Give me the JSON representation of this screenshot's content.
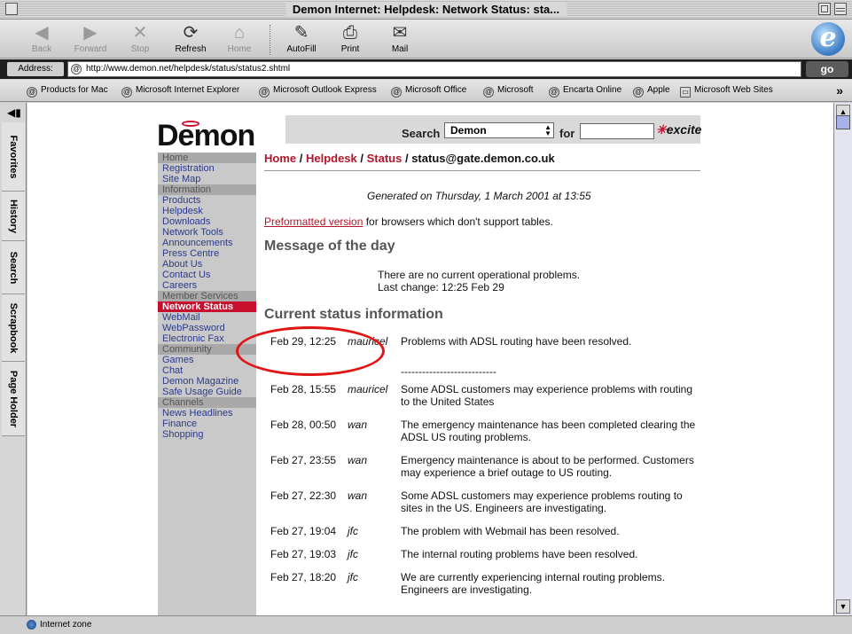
{
  "window": {
    "title": "Demon Internet: Helpdesk: Network Status: sta..."
  },
  "toolbar": {
    "back": "Back",
    "forward": "Forward",
    "stop": "Stop",
    "refresh": "Refresh",
    "home": "Home",
    "autofill": "AutoFill",
    "print": "Print",
    "mail": "Mail"
  },
  "address": {
    "label": "Address:",
    "url": "http://www.demon.net/helpdesk/status/status2.shtml",
    "go": "go"
  },
  "favorites": [
    "Products for Mac",
    "Microsoft Internet Explorer",
    "Microsoft Outlook Express",
    "Microsoft Office",
    "Microsoft",
    "Encarta Online",
    "Apple",
    "Microsoft Web Sites"
  ],
  "sidetabs": [
    "Favorites",
    "History",
    "Search",
    "Scrapbook",
    "Page Holder"
  ],
  "status_bar": "Internet zone",
  "site": {
    "logo": "Demon",
    "search_label": "Search",
    "search_select": "Demon",
    "for_label": "for",
    "excite": "excite",
    "nav": [
      {
        "label": "Home",
        "kind": "section"
      },
      {
        "label": "Registration",
        "kind": "link"
      },
      {
        "label": "Site Map",
        "kind": "link"
      },
      {
        "label": "Information",
        "kind": "section"
      },
      {
        "label": "Products",
        "kind": "link"
      },
      {
        "label": "Helpdesk",
        "kind": "link"
      },
      {
        "label": "Downloads",
        "kind": "link"
      },
      {
        "label": "Network Tools",
        "kind": "link"
      },
      {
        "label": "Announcements",
        "kind": "link"
      },
      {
        "label": "Press Centre",
        "kind": "link"
      },
      {
        "label": "About Us",
        "kind": "link"
      },
      {
        "label": "Contact Us",
        "kind": "link"
      },
      {
        "label": "Careers",
        "kind": "link"
      },
      {
        "label": "Member Services",
        "kind": "section"
      },
      {
        "label": "Network Status",
        "kind": "active"
      },
      {
        "label": "WebMail",
        "kind": "link"
      },
      {
        "label": "WebPassword",
        "kind": "link"
      },
      {
        "label": "Electronic Fax",
        "kind": "link"
      },
      {
        "label": "Community",
        "kind": "section"
      },
      {
        "label": "Games",
        "kind": "link"
      },
      {
        "label": "Chat",
        "kind": "link"
      },
      {
        "label": "Demon Magazine",
        "kind": "link"
      },
      {
        "label": "Safe Usage Guide",
        "kind": "link"
      },
      {
        "label": "Channels",
        "kind": "section"
      },
      {
        "label": "News Headlines",
        "kind": "link"
      },
      {
        "label": "Finance",
        "kind": "link"
      },
      {
        "label": "Shopping",
        "kind": "link"
      }
    ],
    "breadcrumb": {
      "home": "Home",
      "helpdesk": "Helpdesk",
      "status": "Status",
      "current": "status@gate.demon.co.uk",
      "sep": " / "
    },
    "generated": "Generated on Thursday, 1 March 2001 at 13:55",
    "preformatted_link": "Preformatted version",
    "preformatted_rest": " for browsers which don't support tables.",
    "motd_heading": "Message of the day",
    "motd_line1": "There are no current operational problems.",
    "motd_line2": "Last change: 12:25 Feb 29",
    "status_heading": "Current status information",
    "separator": "---------------------------",
    "entries": [
      {
        "date": "Feb 29, 12:25",
        "who": "mauricel",
        "msg": "Problems with ADSL routing have been resolved."
      },
      {
        "date": "Feb 28, 15:55",
        "who": "mauricel",
        "msg": "Some ADSL customers may experience problems with routing to the United States"
      },
      {
        "date": "Feb 28, 00:50",
        "who": "wan",
        "msg": "The emergency maintenance has been completed clearing the ADSL US routing problems."
      },
      {
        "date": "Feb 27, 23:55",
        "who": "wan",
        "msg": "Emergency maintenance is about to be performed. Customers may experience a brief outage to US routing."
      },
      {
        "date": "Feb 27, 22:30",
        "who": "wan",
        "msg": "Some ADSL customers may experience problems routing to sites in the US. Engineers are investigating."
      },
      {
        "date": "Feb 27, 19:04",
        "who": "jfc",
        "msg": "The problem with Webmail has been resolved."
      },
      {
        "date": "Feb 27, 19:03",
        "who": "jfc",
        "msg": "The internal routing problems have been resolved."
      },
      {
        "date": "Feb 27, 18:20",
        "who": "jfc",
        "msg": "We are currently experiencing internal routing problems. Engineers are investigating."
      }
    ]
  }
}
